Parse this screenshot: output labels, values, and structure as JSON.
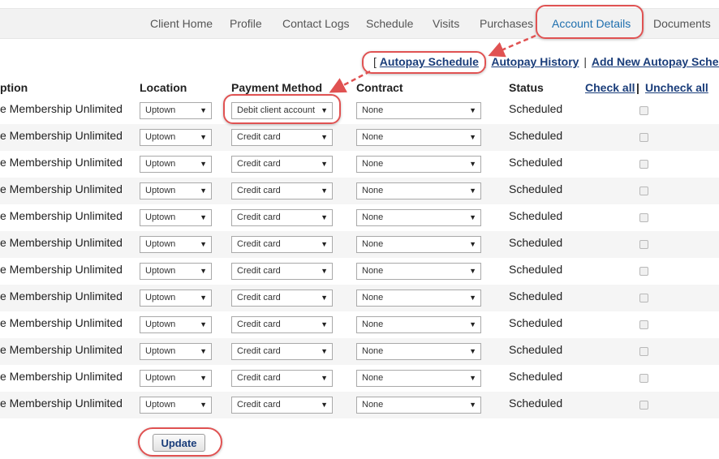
{
  "nav": {
    "tabs": [
      "Client Home",
      "Profile",
      "Contact Logs",
      "Schedule",
      "Visits",
      "Purchases",
      "Account Details",
      "Documents"
    ],
    "active": "Account Details"
  },
  "links": {
    "open_bracket": "[",
    "autopay_schedule": "Autopay Schedule",
    "pipe": "|",
    "autopay_history": "Autopay History",
    "add_new": "Add New Autopay Schedule",
    "close_bracket": "]"
  },
  "table": {
    "headers": {
      "description": "ption",
      "location": "Location",
      "payment_method": "Payment Method",
      "contract": "Contract",
      "status": "Status",
      "check_all": "Check all",
      "pipe": "|",
      "uncheck_all": "Uncheck all"
    },
    "rows": [
      {
        "description": "e Membership Unlimited",
        "location": "Uptown",
        "payment": "Debit client account",
        "contract": "None",
        "status": "Scheduled"
      },
      {
        "description": "e Membership Unlimited",
        "location": "Uptown",
        "payment": "Credit card",
        "contract": "None",
        "status": "Scheduled"
      },
      {
        "description": "e Membership Unlimited",
        "location": "Uptown",
        "payment": "Credit card",
        "contract": "None",
        "status": "Scheduled"
      },
      {
        "description": "e Membership Unlimited",
        "location": "Uptown",
        "payment": "Credit card",
        "contract": "None",
        "status": "Scheduled"
      },
      {
        "description": "e Membership Unlimited",
        "location": "Uptown",
        "payment": "Credit card",
        "contract": "None",
        "status": "Scheduled"
      },
      {
        "description": "e Membership Unlimited",
        "location": "Uptown",
        "payment": "Credit card",
        "contract": "None",
        "status": "Scheduled"
      },
      {
        "description": "e Membership Unlimited",
        "location": "Uptown",
        "payment": "Credit card",
        "contract": "None",
        "status": "Scheduled"
      },
      {
        "description": "e Membership Unlimited",
        "location": "Uptown",
        "payment": "Credit card",
        "contract": "None",
        "status": "Scheduled"
      },
      {
        "description": "e Membership Unlimited",
        "location": "Uptown",
        "payment": "Credit card",
        "contract": "None",
        "status": "Scheduled"
      },
      {
        "description": "e Membership Unlimited",
        "location": "Uptown",
        "payment": "Credit card",
        "contract": "None",
        "status": "Scheduled"
      },
      {
        "description": "e Membership Unlimited",
        "location": "Uptown",
        "payment": "Credit card",
        "contract": "None",
        "status": "Scheduled"
      },
      {
        "description": "e Membership Unlimited",
        "location": "Uptown",
        "payment": "Credit card",
        "contract": "None",
        "status": "Scheduled"
      }
    ]
  },
  "update_label": "Update",
  "icons": {
    "dropdown": "caret-down-icon"
  },
  "colors": {
    "annotation": "#e05252",
    "link": "#1a3d7a",
    "active_tab": "#1e6fae"
  }
}
